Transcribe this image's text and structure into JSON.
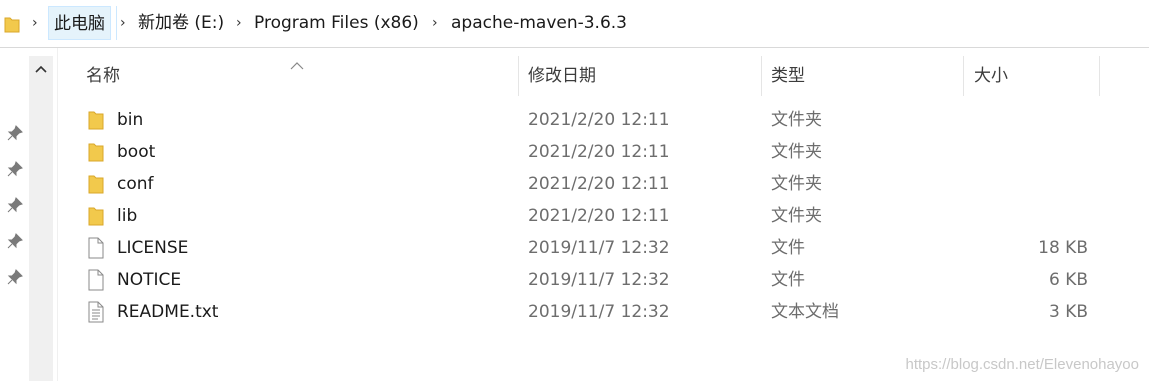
{
  "breadcrumb": {
    "items": [
      "此电脑",
      "新加卷 (E:)",
      "Program Files (x86)",
      "apache-maven-3.6.3"
    ]
  },
  "columns": {
    "name": "名称",
    "modified": "修改日期",
    "type": "类型",
    "size": "大小"
  },
  "files": [
    {
      "name": "bin",
      "modified": "2021/2/20 12:11",
      "type": "文件夹",
      "size": "",
      "icon": "folder-icon"
    },
    {
      "name": "boot",
      "modified": "2021/2/20 12:11",
      "type": "文件夹",
      "size": "",
      "icon": "folder-icon"
    },
    {
      "name": "conf",
      "modified": "2021/2/20 12:11",
      "type": "文件夹",
      "size": "",
      "icon": "folder-icon"
    },
    {
      "name": "lib",
      "modified": "2021/2/20 12:11",
      "type": "文件夹",
      "size": "",
      "icon": "folder-icon"
    },
    {
      "name": "LICENSE",
      "modified": "2019/11/7 12:32",
      "type": "文件",
      "size": "18 KB",
      "icon": "file-icon"
    },
    {
      "name": "NOTICE",
      "modified": "2019/11/7 12:32",
      "type": "文件",
      "size": "6 KB",
      "icon": "file-icon"
    },
    {
      "name": "README.txt",
      "modified": "2019/11/7 12:32",
      "type": "文本文档",
      "size": "3 KB",
      "icon": "text-file-icon"
    }
  ],
  "watermark": "https://blog.csdn.net/Elevenohayoo",
  "colors": {
    "folder": "#f2c94c",
    "selection": "#e5f3fb",
    "selection_border": "#cce8ff"
  }
}
